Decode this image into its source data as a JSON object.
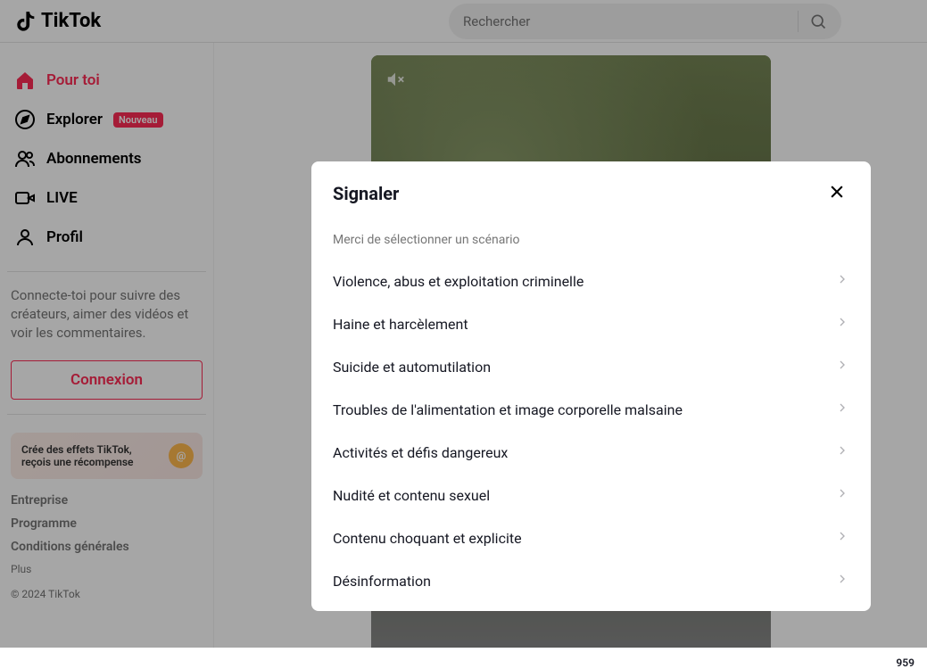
{
  "header": {
    "brand": "TikTok",
    "search_placeholder": "Rechercher"
  },
  "sidebar": {
    "nav": [
      {
        "label": "Pour toi",
        "icon": "home-icon",
        "active": true
      },
      {
        "label": "Explorer",
        "icon": "compass-icon",
        "badge": "Nouveau"
      },
      {
        "label": "Abonnements",
        "icon": "users-icon"
      },
      {
        "label": "LIVE",
        "icon": "video-icon"
      },
      {
        "label": "Profil",
        "icon": "person-icon"
      }
    ],
    "login_prompt": "Connecte-toi pour suivre des créateurs, aimer des vidéos et voir les commentaires.",
    "login_button": "Connexion",
    "promo_line1": "Crée des effets TikTok,",
    "promo_line2": "reçois une récompense",
    "footer_links": [
      "Entreprise",
      "Programme",
      "Conditions générales"
    ],
    "more": "Plus",
    "copyright": "© 2024 TikTok"
  },
  "side_count": "959",
  "modal": {
    "title": "Signaler",
    "subtitle": "Merci de sélectionner un scénario",
    "items": [
      "Violence, abus et exploitation criminelle",
      "Haine et harcèlement",
      "Suicide et automutilation",
      "Troubles de l'alimentation et image corporelle malsaine",
      "Activités et défis dangereux",
      "Nudité et contenu sexuel",
      "Contenu choquant et explicite",
      "Désinformation"
    ]
  }
}
